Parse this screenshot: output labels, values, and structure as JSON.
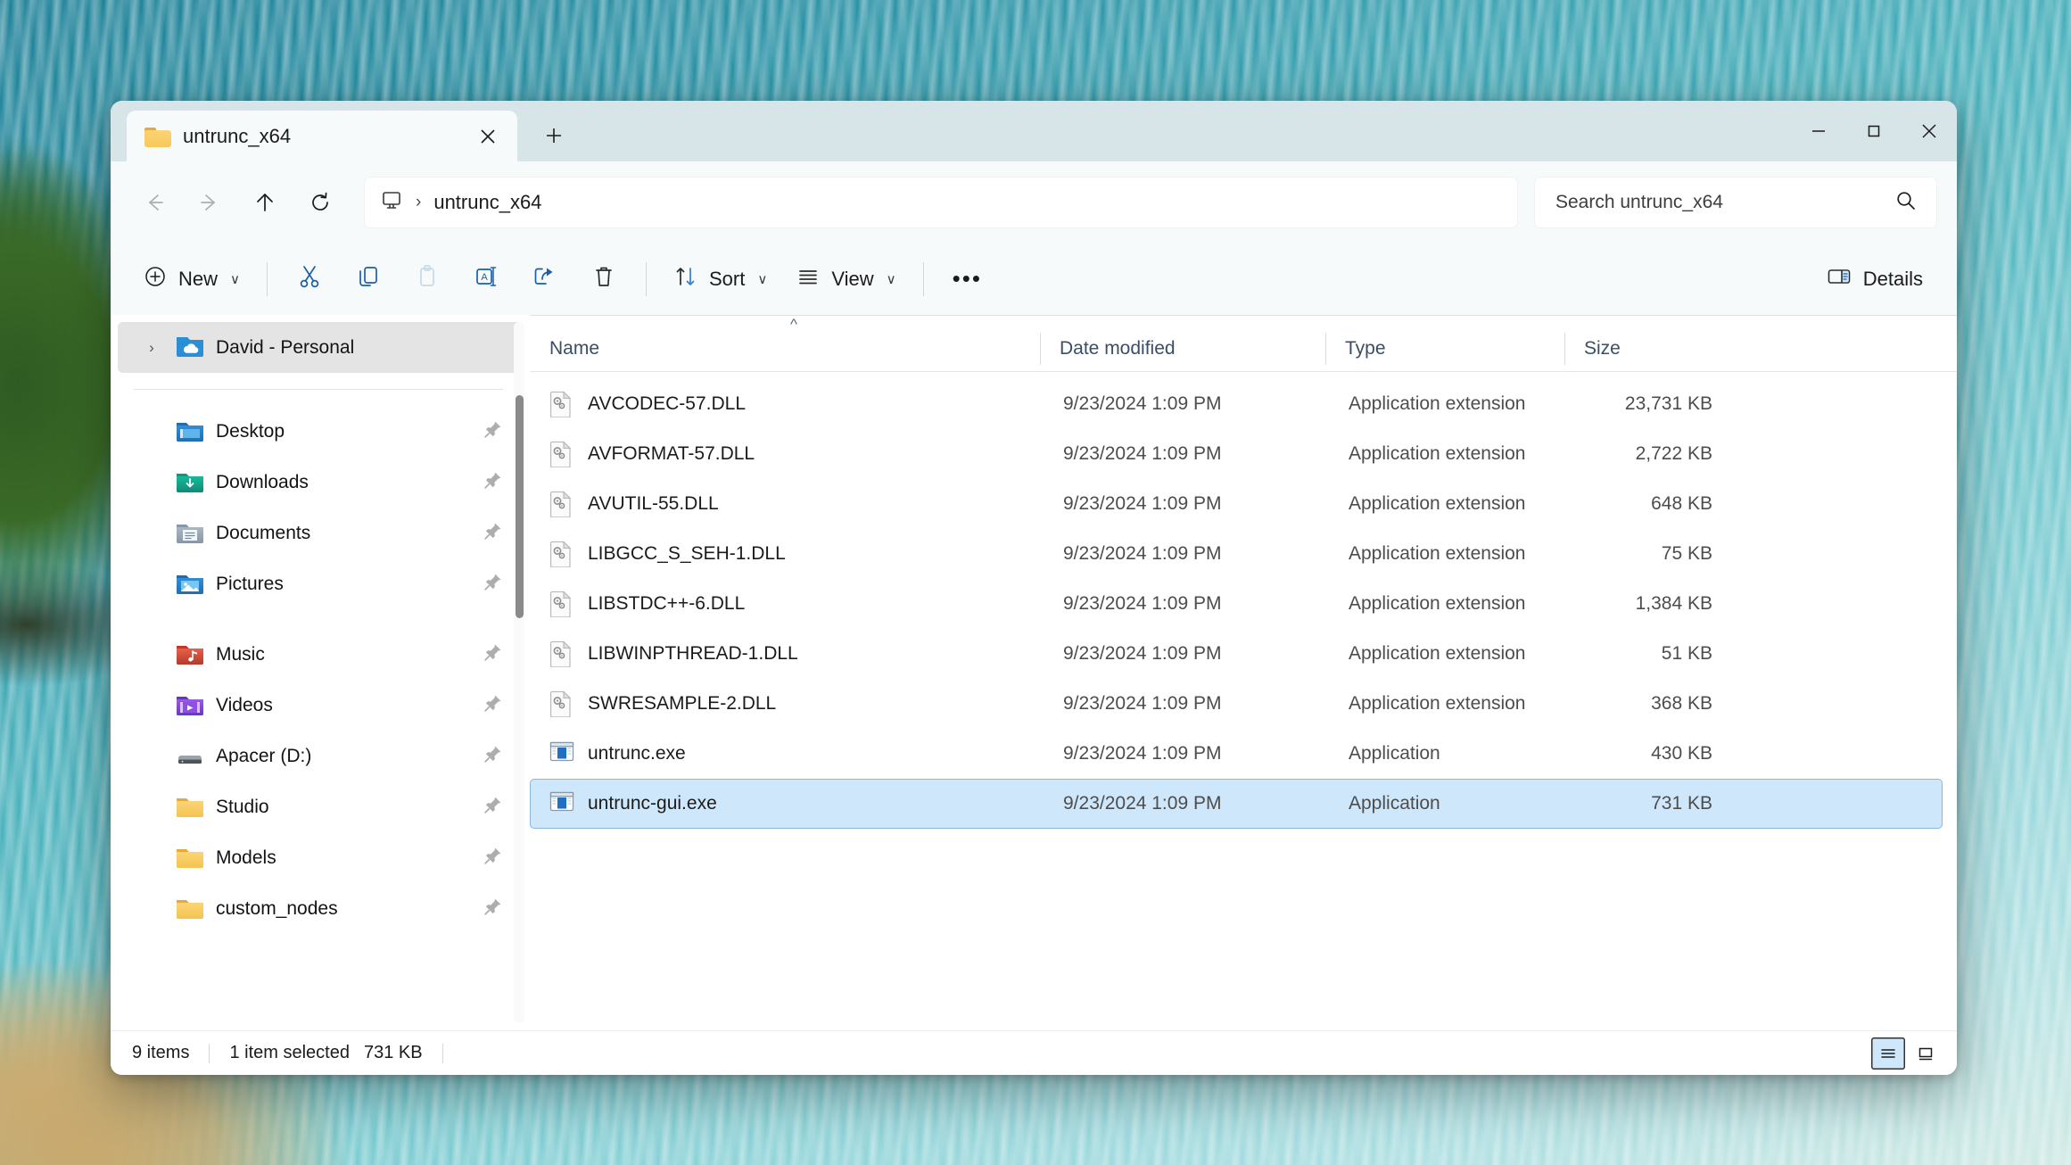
{
  "window": {
    "tab_title": "untrunc_x64",
    "tab_close_glyph": "✕",
    "tab_new_glyph": "＋",
    "minimize_glyph": "─",
    "maximize_glyph": "□",
    "close_glyph": "✕"
  },
  "nav": {
    "back_label": "Back",
    "forward_label": "Forward",
    "up_label": "Up",
    "refresh_label": "Refresh",
    "breadcrumb_root_icon": "this-pc-icon",
    "breadcrumb_separator": "›",
    "breadcrumb_current": "untrunc_x64"
  },
  "search": {
    "placeholder": "Search untrunc_x64",
    "value": ""
  },
  "toolbar": {
    "new_label": "New",
    "new_chevron": "∨",
    "cut_label": "Cut",
    "copy_label": "Copy",
    "paste_label": "Paste",
    "rename_label": "Rename",
    "share_label": "Share",
    "delete_label": "Delete",
    "sort_label": "Sort",
    "sort_chevron": "∨",
    "view_label": "View",
    "view_chevron": "∨",
    "more_label": "•••",
    "details_label": "Details"
  },
  "sidebar": {
    "account": {
      "label": "David - Personal",
      "expand_glyph": "›",
      "selected": true
    },
    "items": [
      {
        "label": "Desktop",
        "icon": "desktop-folder-icon",
        "pinned": true
      },
      {
        "label": "Downloads",
        "icon": "downloads-folder-icon",
        "pinned": true
      },
      {
        "label": "Documents",
        "icon": "documents-folder-icon",
        "pinned": true
      },
      {
        "label": "Pictures",
        "icon": "pictures-folder-icon",
        "pinned": true
      },
      {
        "label": "Music",
        "icon": "music-folder-icon",
        "pinned": true
      },
      {
        "label": "Videos",
        "icon": "videos-folder-icon",
        "pinned": true
      },
      {
        "label": "Apacer (D:)",
        "icon": "drive-icon",
        "pinned": true
      },
      {
        "label": "Studio",
        "icon": "folder-icon",
        "pinned": true
      },
      {
        "label": "Models",
        "icon": "folder-icon",
        "pinned": true
      },
      {
        "label": "custom_nodes",
        "icon": "folder-icon",
        "pinned": true
      }
    ]
  },
  "filelist": {
    "columns": [
      "Name",
      "Date modified",
      "Type",
      "Size"
    ],
    "sort_column": "Name",
    "sort_direction": "ascending",
    "rows": [
      {
        "name": "AVCODEC-57.DLL",
        "date": "9/23/2024 1:09 PM",
        "type": "Application extension",
        "size": "23,731 KB",
        "icon": "dll-icon",
        "selected": false
      },
      {
        "name": "AVFORMAT-57.DLL",
        "date": "9/23/2024 1:09 PM",
        "type": "Application extension",
        "size": "2,722 KB",
        "icon": "dll-icon",
        "selected": false
      },
      {
        "name": "AVUTIL-55.DLL",
        "date": "9/23/2024 1:09 PM",
        "type": "Application extension",
        "size": "648 KB",
        "icon": "dll-icon",
        "selected": false
      },
      {
        "name": "LIBGCC_S_SEH-1.DLL",
        "date": "9/23/2024 1:09 PM",
        "type": "Application extension",
        "size": "75 KB",
        "icon": "dll-icon",
        "selected": false
      },
      {
        "name": "LIBSTDC++-6.DLL",
        "date": "9/23/2024 1:09 PM",
        "type": "Application extension",
        "size": "1,384 KB",
        "icon": "dll-icon",
        "selected": false
      },
      {
        "name": "LIBWINPTHREAD-1.DLL",
        "date": "9/23/2024 1:09 PM",
        "type": "Application extension",
        "size": "51 KB",
        "icon": "dll-icon",
        "selected": false
      },
      {
        "name": "SWRESAMPLE-2.DLL",
        "date": "9/23/2024 1:09 PM",
        "type": "Application extension",
        "size": "368 KB",
        "icon": "dll-icon",
        "selected": false
      },
      {
        "name": "untrunc.exe",
        "date": "9/23/2024 1:09 PM",
        "type": "Application",
        "size": "430 KB",
        "icon": "exe-icon",
        "selected": false
      },
      {
        "name": "untrunc-gui.exe",
        "date": "9/23/2024 1:09 PM",
        "type": "Application",
        "size": "731 KB",
        "icon": "exe-icon",
        "selected": true
      }
    ]
  },
  "statusbar": {
    "item_count": "9 items",
    "selection": "1 item selected",
    "selection_size": "731 KB",
    "details_view_label": "Details view",
    "large_icons_view_label": "Large icons view",
    "active_view": "details"
  },
  "colors": {
    "accent": "#0f6cbd",
    "selection": "#cfe7fb",
    "titlebar": "#d7e5e8",
    "chrome": "#f6fafb"
  }
}
